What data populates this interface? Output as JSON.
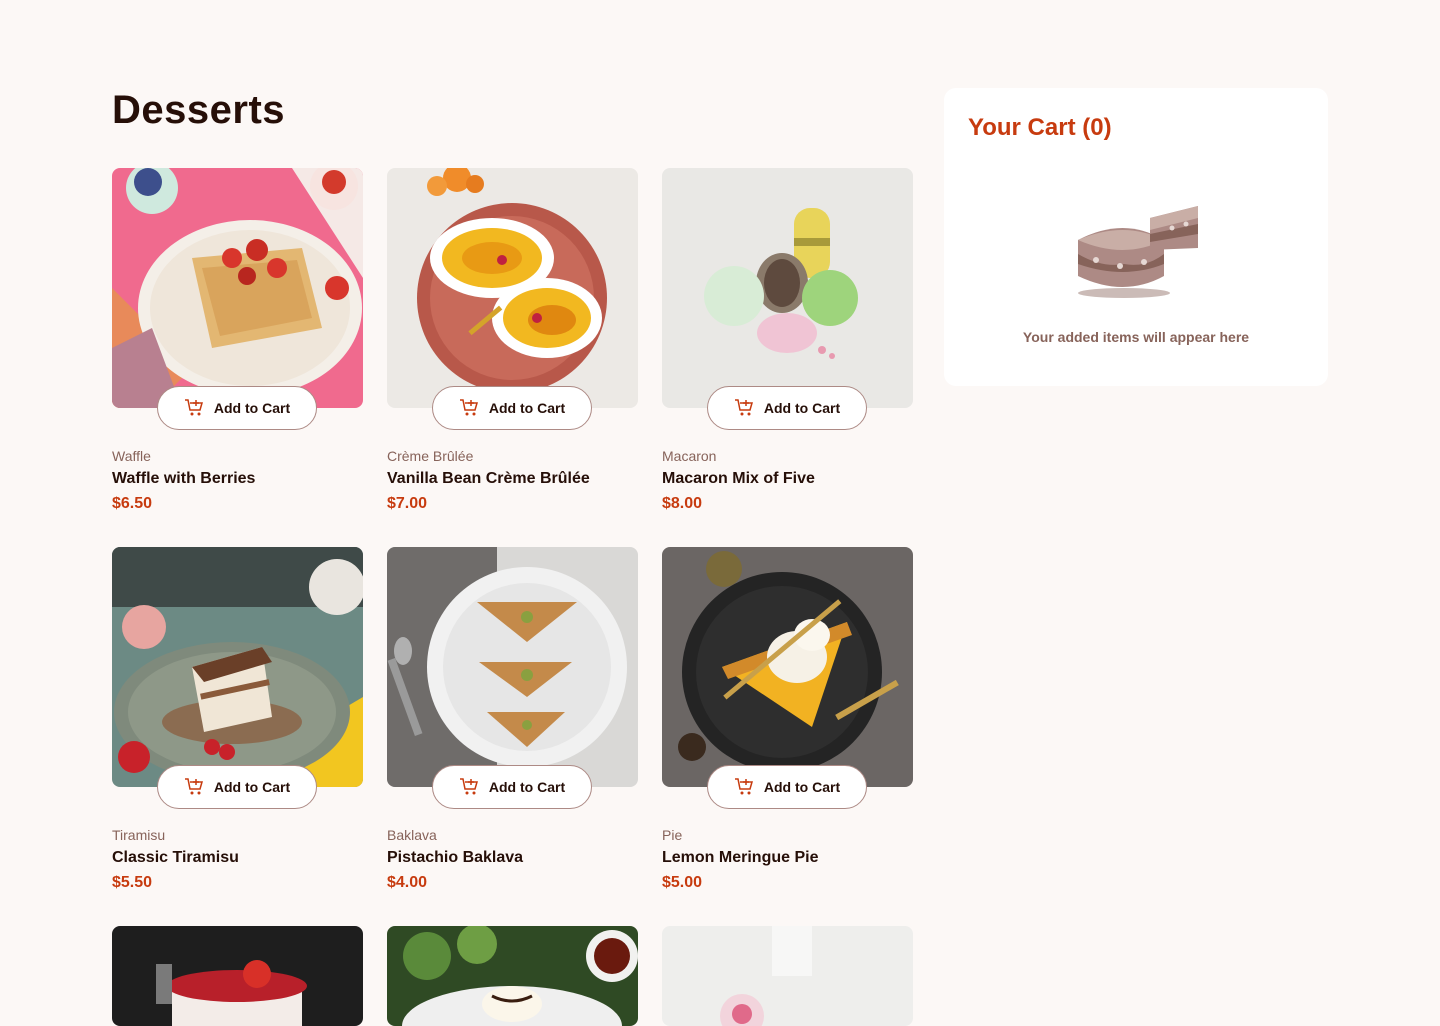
{
  "page": {
    "title": "Desserts"
  },
  "colors": {
    "accent": "#c73b0f",
    "rose_900": "#260f08",
    "rose_500": "#87635a",
    "background": "#fcf8f6"
  },
  "products": [
    {
      "category": "Waffle",
      "name": "Waffle with Berries",
      "price": "$6.50",
      "button": "Add to Cart"
    },
    {
      "category": "Crème Brûlée",
      "name": "Vanilla Bean Crème Brûlée",
      "price": "$7.00",
      "button": "Add to Cart"
    },
    {
      "category": "Macaron",
      "name": "Macaron Mix of Five",
      "price": "$8.00",
      "button": "Add to Cart"
    },
    {
      "category": "Tiramisu",
      "name": "Classic Tiramisu",
      "price": "$5.50",
      "button": "Add to Cart"
    },
    {
      "category": "Baklava",
      "name": "Pistachio Baklava",
      "price": "$4.00",
      "button": "Add to Cart"
    },
    {
      "category": "Pie",
      "name": "Lemon Meringue Pie",
      "price": "$5.00",
      "button": "Add to Cart"
    }
  ],
  "cart": {
    "title": "Your Cart (0)",
    "empty_message": "Your added items will appear here",
    "empty_icon": "cake-icon"
  },
  "icons": {
    "add_to_cart": "cart-add-icon"
  }
}
